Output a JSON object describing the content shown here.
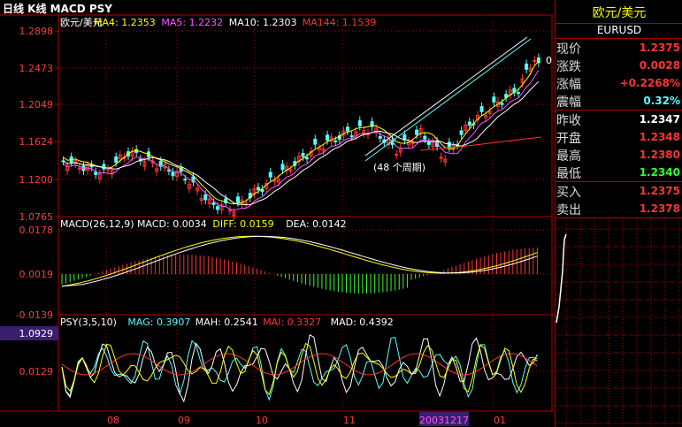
{
  "window": {
    "title": "日线 K线 MACD PSY"
  },
  "colors": {
    "up": "#ff3333",
    "down": "#54ffff",
    "grid": "#b00000",
    "axis": "#ff3b3b",
    "flat": "#ffffff",
    "green": "#33ff33",
    "yellow": "#ffff00",
    "magenta": "#ff55ff"
  },
  "price_panel": {
    "legend": [
      {
        "text": "欧元/美元",
        "color": "#ffffff"
      },
      {
        "text": "MA4: 1.2353",
        "color": "#ffff00"
      },
      {
        "text": "MA5: 1.2232",
        "color": "#ff55ff"
      },
      {
        "text": "MA10: 1.2303",
        "color": "#ffffff"
      },
      {
        "text": "MA144: 1.1539",
        "color": "#ff3333"
      }
    ],
    "y_ticks": [
      "1.2898",
      "1.2473",
      "1.2049",
      "1.1624",
      "1.1200",
      "1.0765"
    ],
    "annotation": "(48 个周期)",
    "edge_char": "0"
  },
  "macd_panel": {
    "legend": [
      {
        "text": "MACD(26,12,9) MACD: 0.0034",
        "color": "#ffffff"
      },
      {
        "text": "DIFF: 0.0159",
        "color": "#ffff00"
      },
      {
        "text": "DEA: 0.0142",
        "color": "#ffffff"
      }
    ],
    "y_ticks": [
      "0.0178",
      "0.0019",
      "-0.0139"
    ]
  },
  "psy_panel": {
    "legend": [
      {
        "text": "PSY(3,5,10)",
        "color": "#ffffff"
      },
      {
        "text": "MAG: 0.3907",
        "color": "#54ffff"
      },
      {
        "text": "MAH: 0.2541",
        "color": "#ffffff"
      },
      {
        "text": "MAI: 0.3327",
        "color": "#ff3333"
      },
      {
        "text": "MAD: 0.4392",
        "color": "#ffffff"
      }
    ],
    "y_ticks": [
      "0.0129"
    ],
    "cursor_value": "1.0929"
  },
  "x_axis": {
    "labels": [
      "08",
      "09",
      "10",
      "11",
      "01"
    ],
    "cursor_date": "20031217"
  },
  "quote": {
    "title": "欧元/美元",
    "symbol": "EURUSD",
    "rows": [
      {
        "label": "现价",
        "value": "1.2375",
        "color": "#ff3333"
      },
      {
        "label": "涨跌",
        "value": "0.0028",
        "color": "#ff3333"
      },
      {
        "label": "涨幅",
        "value": "+0.2268%",
        "color": "#ff3333"
      },
      {
        "label": "震幅",
        "value": "0.32%",
        "color": "#54ffff"
      },
      {
        "label": "昨收",
        "value": "1.2347",
        "color": "#ffffff"
      },
      {
        "label": "开盘",
        "value": "1.2348",
        "color": "#ff3333"
      },
      {
        "label": "最高",
        "value": "1.2380",
        "color": "#ff3333"
      },
      {
        "label": "最低",
        "value": "1.2340",
        "color": "#33ff33"
      },
      {
        "label": "买入",
        "value": "1.2375",
        "color": "#ff3333"
      },
      {
        "label": "卖出",
        "value": "1.2378",
        "color": "#ff3333"
      }
    ]
  }
}
